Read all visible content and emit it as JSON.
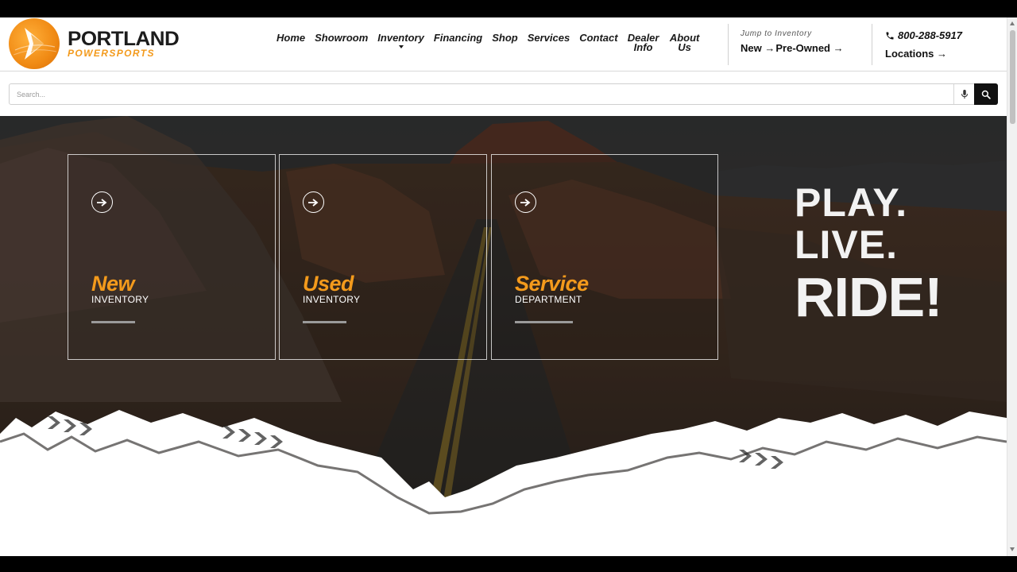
{
  "header": {
    "logo": {
      "line1": "PORTLAND",
      "line2": "POWERSPORTS"
    },
    "nav": [
      {
        "label": "Home"
      },
      {
        "label": "Showroom"
      },
      {
        "label": "Inventory",
        "has_dropdown": true
      },
      {
        "label": "Financing"
      },
      {
        "label": "Shop"
      },
      {
        "label": "Services"
      },
      {
        "label": "Contact"
      },
      {
        "label": "Dealer Info"
      },
      {
        "label": "About Us"
      }
    ],
    "jump": {
      "label": "Jump to Inventory",
      "new": "New",
      "pre_owned": "Pre-Owned"
    },
    "phone": "800-288-5917",
    "locations": "Locations"
  },
  "search": {
    "placeholder": "Search..."
  },
  "hero": {
    "cards": [
      {
        "title": "New",
        "subtitle": "INVENTORY"
      },
      {
        "title": "Used",
        "subtitle": "INVENTORY"
      },
      {
        "title": "Service",
        "subtitle": "DEPARTMENT"
      }
    ],
    "slogan": {
      "line1": "PLAY.",
      "line2": "LIVE.",
      "line3": "RIDE!"
    }
  },
  "colors": {
    "accent": "#f39a1c",
    "text": "#1a1a1a",
    "hero_overlay": "#1a1714"
  },
  "icons": [
    "logo-chevron-icon",
    "dropdown-caret-icon",
    "phone-icon",
    "microphone-icon",
    "search-icon",
    "arrow-circle-icon"
  ]
}
